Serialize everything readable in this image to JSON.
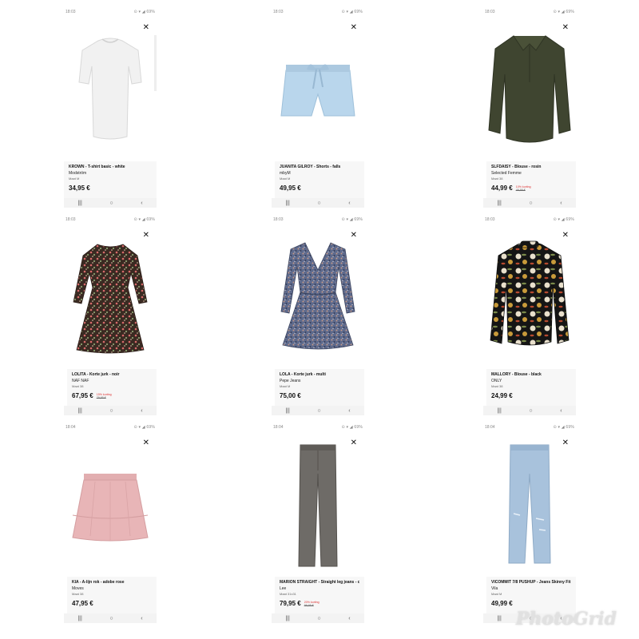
{
  "cells": [
    {
      "time": "18:03",
      "status": "⊙ ▾ ◢ 69%",
      "title": "KROWN - T-shirt basic - white",
      "brand": "Modström",
      "size": "Maat M",
      "price": "34,95 €",
      "discount_pct": "",
      "old_price": ""
    },
    {
      "time": "18:03",
      "status": "⊙ ▾ ◢ 69%",
      "title": "JUANITA GILROY - Shorts - falls",
      "brand": "mbyM",
      "size": "Maat M",
      "price": "49,95 €",
      "discount_pct": "",
      "old_price": ""
    },
    {
      "time": "18:03",
      "status": "⊙ ▾ ◢ 69%",
      "title": "SLFDAISY - Blouse - rosin",
      "brand": "Selected Femme",
      "size": "Maat 38",
      "price": "44,99 €",
      "discount_pct": "10% korting",
      "old_price": "49,99 €"
    },
    {
      "time": "18:03",
      "status": "⊙ ▾ ◢ 69%",
      "title": "LOLITA - Korte jurk - noir",
      "brand": "NAF NAF",
      "size": "Maat 38",
      "price": "67,95 €",
      "discount_pct": "15% korting",
      "old_price": "79,95 €"
    },
    {
      "time": "18:03",
      "status": "⊙ ▾ ◢ 69%",
      "title": "LOLA - Korte jurk - multi",
      "brand": "Pepe Jeans",
      "size": "Maat M",
      "price": "75,00 €",
      "discount_pct": "",
      "old_price": ""
    },
    {
      "time": "18:03",
      "status": "⊙ ▾ ◢ 69%",
      "title": "MALLORY - Blouse - black",
      "brand": "ONLY",
      "size": "Maat 38",
      "price": "24,99 €",
      "discount_pct": "",
      "old_price": ""
    },
    {
      "time": "18:04",
      "status": "⊙ ▾ ◢ 69%",
      "title": "KIA - A-lijn rok - adobe rose",
      "brand": "Moves",
      "size": "Maat 38",
      "price": "47,95 €",
      "discount_pct": "",
      "old_price": ""
    },
    {
      "time": "18:04",
      "status": "⊙ ▾ ◢ 69%",
      "title": "MARION STRAIGHT - Straight leg jeans - comf...",
      "brand": "Lee",
      "size": "Maat 31x31",
      "price": "79,95 €",
      "discount_pct": "20% korting",
      "old_price": "99,95 €"
    },
    {
      "time": "18:04",
      "status": "⊙ ▾ ◢ 69%",
      "title": "VICOMMIT 7/8 PUSHUP - Jeans Skinny Fit - m...",
      "brand": "Vila",
      "size": "Maat M",
      "price": "49,99 €",
      "discount_pct": "",
      "old_price": ""
    }
  ],
  "close_glyph": "✕",
  "nav": {
    "recent": "|||",
    "home": "○",
    "back": "‹"
  },
  "icons": [
    "close-icon",
    "recent-apps-icon",
    "home-icon",
    "back-icon"
  ],
  "watermark": "PhotoGrid"
}
